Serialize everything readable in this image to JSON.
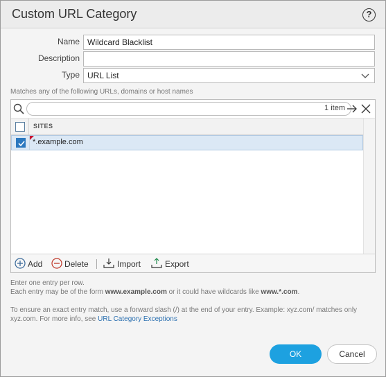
{
  "dialog": {
    "title": "Custom URL Category",
    "help_glyph": "?"
  },
  "form": {
    "name_label": "Name",
    "name_value": "Wildcard Blacklist",
    "description_label": "Description",
    "description_value": "",
    "type_label": "Type",
    "type_value": "URL List"
  },
  "hint": "Matches any of the following URLs, domains or host names",
  "list": {
    "count_text": "1 item",
    "column_header": "SITES",
    "rows": [
      {
        "site": "*.example.com",
        "checked": true
      }
    ]
  },
  "toolbar": {
    "add_label": "Add",
    "delete_label": "Delete",
    "import_label": "Import",
    "export_label": "Export"
  },
  "help": {
    "line1": "Enter one entry per row.",
    "line2_pre": "Each entry may be of the form ",
    "line2_bold1": "www.example.com",
    "line2_mid": " or it could have wildcards like ",
    "line2_bold2": "www.*.com",
    "line2_post": ".",
    "para2_text": "To ensure an exact entry match, use a forward slash (/) at the end of your entry. Example: xyz.com/ matches only xyz.com. For more info, see ",
    "para2_link": "URL Category Exceptions"
  },
  "buttons": {
    "ok": "OK",
    "cancel": "Cancel"
  },
  "colors": {
    "primary_button": "#1da1e0",
    "link": "#2a6fb0",
    "selected_row": "#dbe8f5",
    "checkbox": "#2b78bf"
  }
}
